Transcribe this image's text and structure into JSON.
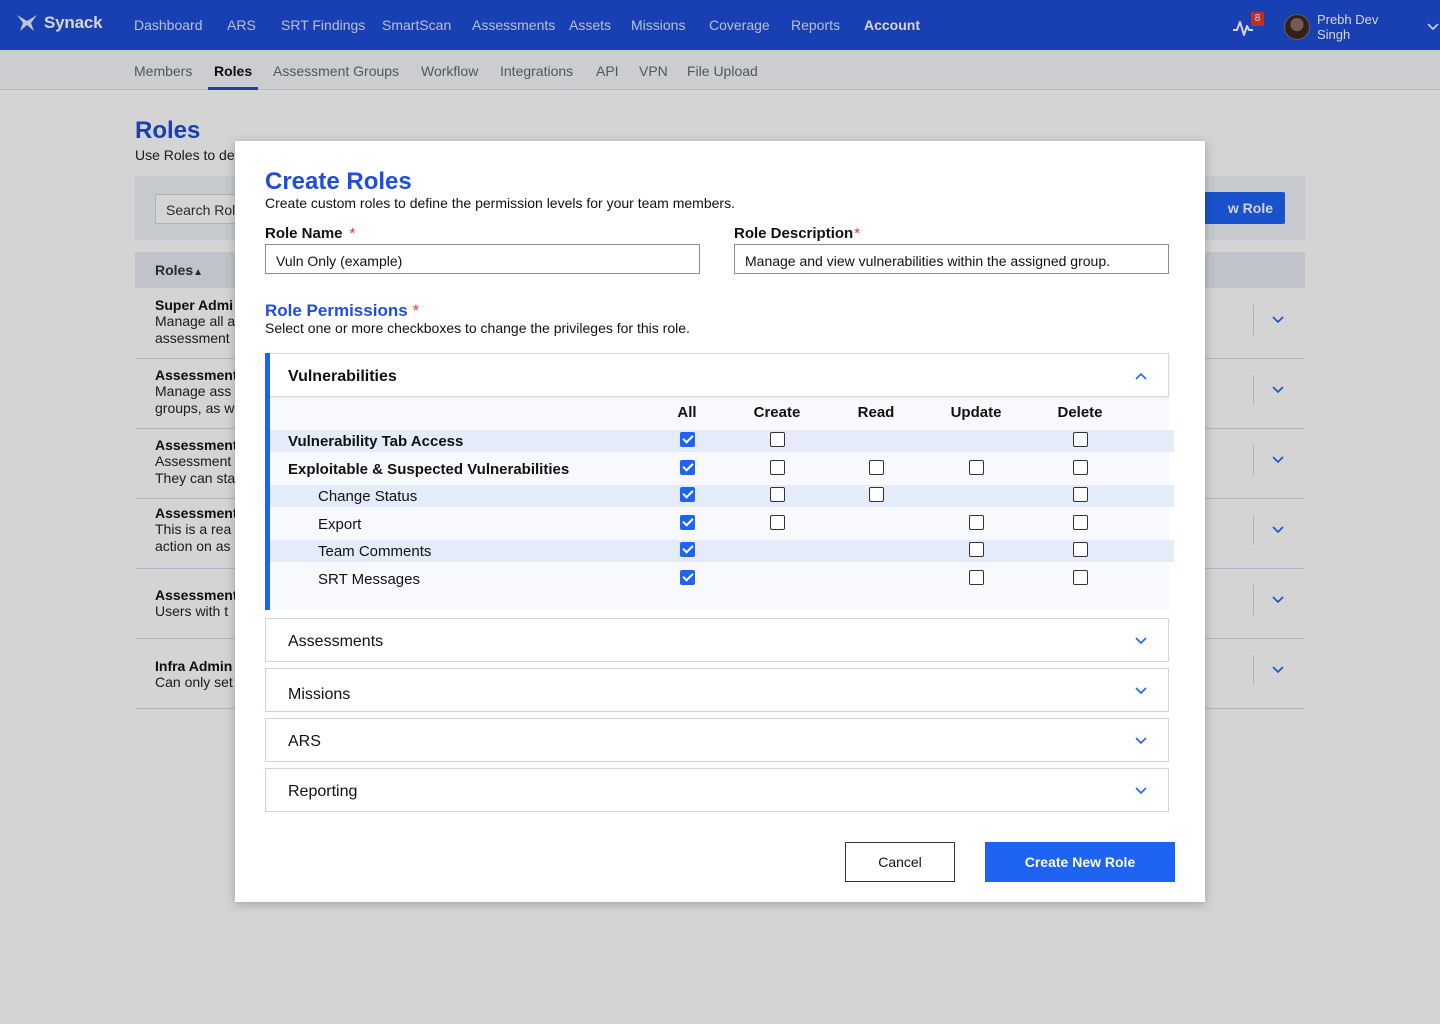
{
  "brand": {
    "name": "Synack",
    "accent": "#1f4ed8",
    "button": "#1f63f3"
  },
  "nav": {
    "items": [
      "Dashboard",
      "ARS",
      "SRT Findings",
      "SmartScan",
      "Assessments",
      "Assets",
      "Missions",
      "Coverage",
      "Reports",
      "Account"
    ],
    "active": "Account",
    "notifications": "8",
    "user": "Prebh Dev Singh"
  },
  "subnav": {
    "items": [
      "Members",
      "Roles",
      "Assessment Groups",
      "Workflow",
      "Integrations",
      "API",
      "VPN",
      "File Upload"
    ],
    "active": "Roles"
  },
  "page": {
    "title": "Roles",
    "subtitle": "Use Roles to de",
    "search_text": "Search Rol",
    "new_role_button": "w Role",
    "table_header": "Roles",
    "rows": [
      {
        "name": "Super Admi",
        "desc": "Manage all a\nassessment"
      },
      {
        "name": "Assessment",
        "desc": "Manage ass\ngroups, as w"
      },
      {
        "name": "Assessment",
        "desc": "Assessment\nThey can sta"
      },
      {
        "name": "Assessment",
        "desc": "This is a rea\naction on as"
      },
      {
        "name": "Assessment",
        "desc": "Users with t"
      },
      {
        "name": "Infra Admin",
        "desc": "Can only set"
      }
    ]
  },
  "modal": {
    "title": "Create Roles",
    "subtitle": "Create custom roles to define the permission levels for your team members.",
    "role_name_label": "Role Name",
    "role_name_value": "Vuln Only (example)",
    "role_desc_label": "Role Description",
    "role_desc_value": "Manage and view vulnerabilities within the assigned group.",
    "required_mark": "*",
    "permissions_title": "Role Permissions",
    "permissions_subtitle": "Select one or more checkboxes to change the privileges for this role.",
    "open_section": "Vulnerabilities",
    "columns": [
      "All",
      "Create",
      "Read",
      "Update",
      "Delete"
    ],
    "permissions": [
      {
        "label": "Vulnerability Tab Access",
        "bold": true,
        "indent": false,
        "cells": [
          true,
          false,
          null,
          null,
          false
        ]
      },
      {
        "label": "Exploitable & Suspected Vulnerabilities",
        "bold": true,
        "indent": false,
        "cells": [
          true,
          false,
          false,
          false,
          false
        ]
      },
      {
        "label": "Change Status",
        "bold": false,
        "indent": true,
        "cells": [
          true,
          false,
          false,
          null,
          false
        ]
      },
      {
        "label": "Export",
        "bold": false,
        "indent": true,
        "cells": [
          true,
          false,
          null,
          false,
          false
        ]
      },
      {
        "label": "Team Comments",
        "bold": false,
        "indent": true,
        "cells": [
          true,
          null,
          null,
          false,
          false
        ]
      },
      {
        "label": "SRT Messages",
        "bold": false,
        "indent": true,
        "cells": [
          true,
          null,
          null,
          false,
          false
        ]
      }
    ],
    "collapsed_sections": [
      "Assessments",
      "Missions",
      "ARS",
      "Reporting"
    ],
    "cancel_button": "Cancel",
    "create_button": "Create New Role"
  }
}
